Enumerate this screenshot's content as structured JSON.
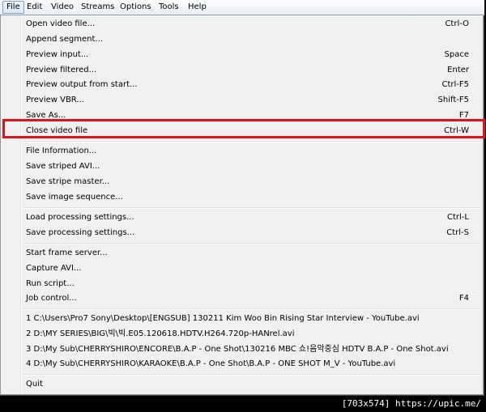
{
  "menubar": [
    "File",
    "Edit",
    "Video",
    "Streams",
    "Options",
    "Tools",
    "Help"
  ],
  "file_menu": {
    "group1": [
      {
        "label": "Open video file...",
        "shortcut": "Ctrl-O"
      },
      {
        "label": "Append segment...",
        "shortcut": ""
      },
      {
        "label": "Preview input...",
        "shortcut": "Space"
      },
      {
        "label": "Preview filtered...",
        "shortcut": "Enter"
      },
      {
        "label": "Preview output from start...",
        "shortcut": "Ctrl-F5"
      },
      {
        "label": "Preview VBR...",
        "shortcut": "Shift-F5"
      },
      {
        "label": "Save As...",
        "shortcut": "F7"
      },
      {
        "label": "Close video file",
        "shortcut": "Ctrl-W"
      }
    ],
    "group2": [
      {
        "label": "File Information...",
        "shortcut": ""
      },
      {
        "label": "Save striped AVI...",
        "shortcut": ""
      },
      {
        "label": "Save stripe master...",
        "shortcut": ""
      },
      {
        "label": "Save image sequence...",
        "shortcut": ""
      }
    ],
    "group3": [
      {
        "label": "Load processing settings...",
        "shortcut": "Ctrl-L"
      },
      {
        "label": "Save processing settings...",
        "shortcut": "Ctrl-S"
      }
    ],
    "group4": [
      {
        "label": "Start frame server...",
        "shortcut": ""
      },
      {
        "label": "Capture AVI...",
        "shortcut": ""
      },
      {
        "label": "Run script...",
        "shortcut": ""
      },
      {
        "label": "Job control...",
        "shortcut": "F4"
      }
    ],
    "recent": [
      "1 C:\\Users\\Pro7 Sony\\Desktop\\[ENGSUB] 130211 Kim Woo Bin Rising Star Interview - YouTube.avi",
      "2 D:\\MY SERIES\\BIG\\빅\\빅.E05.120618.HDTV.H264.720p-HANrel.avi",
      "3 D:\\My Sub\\CHERRYSHIRO\\ENCORE\\B.A.P - One Shot\\130216 MBC 쇼!음악중심 HDTV B.A.P - One Shot.avi",
      "4 D:\\My Sub\\CHERRYSHIRO\\KARAOKE\\B.A.P - One Shot\\B.A.P - ONE SHOT M_V - YouTube.avi"
    ],
    "quit": "Quit"
  },
  "footer": "[703x574] https://upic.me/"
}
